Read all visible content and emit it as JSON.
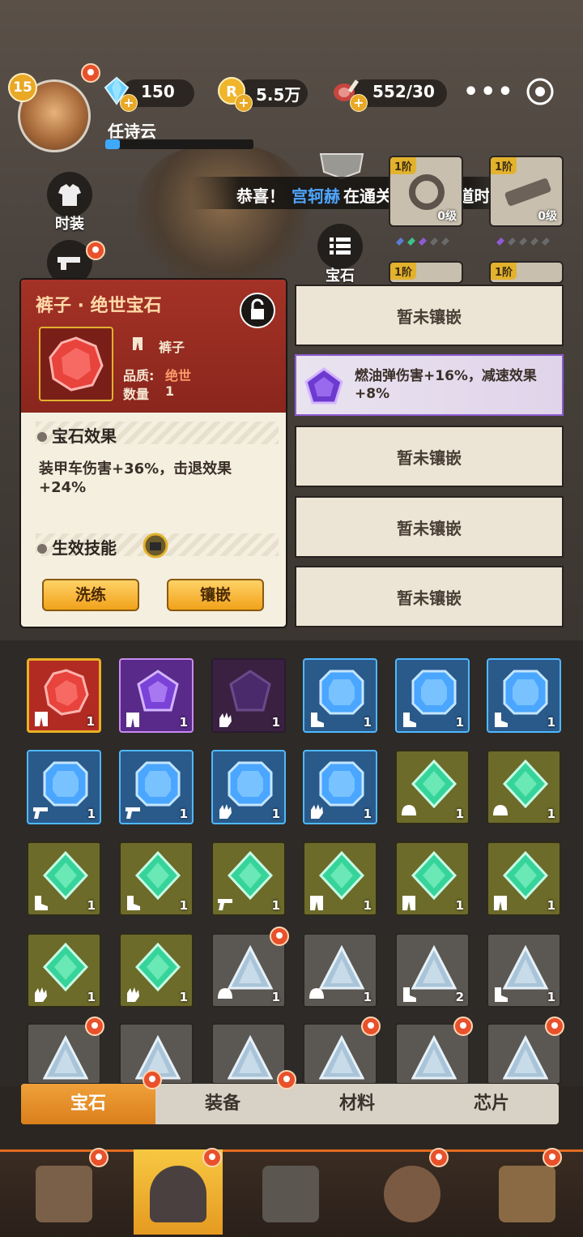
{
  "player": {
    "level": "15",
    "name": "任诗云",
    "xp_fraction": 0.1
  },
  "resources": {
    "diamonds": "150",
    "coins": "5.5万",
    "stamina": "552/30"
  },
  "menu": {
    "more": "•••"
  },
  "side_buttons": {
    "fashion": "时装",
    "gem": "宝石"
  },
  "banner": {
    "prefix": "恭喜！",
    "player": "宫轲赫",
    "suffix": "在通关7.隐秘小道时"
  },
  "equipment": [
    {
      "tier": "1阶",
      "level": "0级"
    },
    {
      "tier": "1阶",
      "level": "0级"
    },
    {
      "tier": "1阶",
      "level": ""
    },
    {
      "tier": "1阶",
      "level": ""
    }
  ],
  "detail": {
    "title": "裤子 · 绝世宝石",
    "slot": "裤子",
    "quality_label": "品质:",
    "quality_value": "绝世",
    "qty_label": "数量",
    "qty_value": "1",
    "effect_header": "宝石效果",
    "effect_text": "装甲车伤害+36%，击退效果+24%",
    "skill_header": "生效技能",
    "refine_button": "洗练",
    "inlay_button": "镶嵌"
  },
  "sockets": [
    {
      "text": "暂未镶嵌",
      "filled": false
    },
    {
      "text": "燃油弹伤害+16%，减速效果+8%",
      "filled": true
    },
    {
      "text": "暂未镶嵌",
      "filled": false
    },
    {
      "text": "暂未镶嵌",
      "filled": false
    },
    {
      "text": "暂未镶嵌",
      "filled": false
    }
  ],
  "inventory": [
    {
      "color": "red",
      "slot": "pants-icon",
      "count": "1"
    },
    {
      "color": "purple",
      "slot": "pants-icon",
      "count": "1"
    },
    {
      "color": "dpurple",
      "slot": "glove-icon",
      "count": "1"
    },
    {
      "color": "blue",
      "slot": "boots-icon",
      "count": "1"
    },
    {
      "color": "blue",
      "slot": "boots-icon",
      "count": "1"
    },
    {
      "color": "blue",
      "slot": "boots-icon",
      "count": "1"
    },
    {
      "color": "blue",
      "slot": "gun-icon",
      "count": "1"
    },
    {
      "color": "blue",
      "slot": "gun-icon",
      "count": "1"
    },
    {
      "color": "blue",
      "slot": "glove-icon",
      "count": "1"
    },
    {
      "color": "blue",
      "slot": "glove-icon",
      "count": "1"
    },
    {
      "color": "green",
      "slot": "helmet-icon",
      "count": "1"
    },
    {
      "color": "green",
      "slot": "helmet-icon",
      "count": "1"
    },
    {
      "color": "green",
      "slot": "boots-icon",
      "count": "1"
    },
    {
      "color": "green",
      "slot": "boots-icon",
      "count": "1"
    },
    {
      "color": "green",
      "slot": "gun-icon",
      "count": "1"
    },
    {
      "color": "green",
      "slot": "pants-icon",
      "count": "1"
    },
    {
      "color": "green",
      "slot": "pants-icon",
      "count": "1"
    },
    {
      "color": "green",
      "slot": "pants-icon",
      "count": "1"
    },
    {
      "color": "green",
      "slot": "glove-icon",
      "count": "1"
    },
    {
      "color": "green",
      "slot": "glove-icon",
      "count": "1"
    },
    {
      "color": "grey",
      "slot": "helmet-icon",
      "count": "1"
    },
    {
      "color": "grey",
      "slot": "helmet-icon",
      "count": "1"
    },
    {
      "color": "grey",
      "slot": "boots-icon",
      "count": "2"
    },
    {
      "color": "grey",
      "slot": "boots-icon",
      "count": "1"
    },
    {
      "color": "grey",
      "slot": "",
      "count": ""
    },
    {
      "color": "grey",
      "slot": "",
      "count": ""
    },
    {
      "color": "grey",
      "slot": "",
      "count": ""
    },
    {
      "color": "grey",
      "slot": "",
      "count": ""
    },
    {
      "color": "grey",
      "slot": "",
      "count": ""
    },
    {
      "color": "grey",
      "slot": "",
      "count": ""
    }
  ],
  "tabs": [
    "宝石",
    "装备",
    "材料",
    "芯片"
  ],
  "nav": [
    "base-icon",
    "hero-icon",
    "weapon-icon",
    "core-icon",
    "tower-icon"
  ]
}
